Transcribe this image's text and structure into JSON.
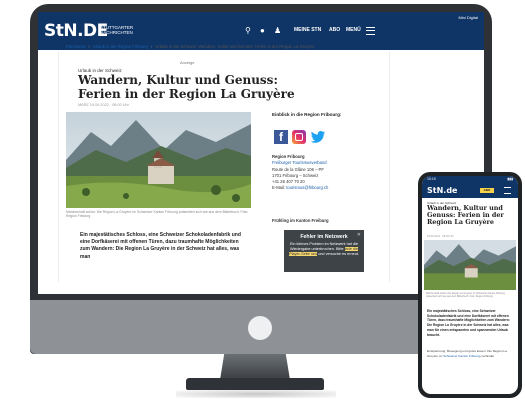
{
  "desktop": {
    "header": {
      "logo": "StN.DE",
      "logo_sub": "STUTTGARTER NACHRICHTEN",
      "corner_label": "Mini Digital",
      "nav": [
        "MEINE STN",
        "ABO",
        "MENÜ"
      ]
    },
    "breadcrumbs": [
      "Panorama",
      "Urlaub in der Region Fribourg",
      "Urlaub in der Schweiz: Wandern, Kultur und Genuss: Ferien in der Region La Gruyère"
    ],
    "article": {
      "ad_label": "Anzeige",
      "kicker": "Urlaub in der Schweiz",
      "headline": "Wandern, Kultur und Genuss: Ferien in der Region La Gruyère",
      "dateline": "MÄRZ 19.09.2022 · 08:00 Uhr",
      "photo_caption": "Märchenhaft schön: Die Region La Gruyère im Schweizer Kanton Fribourg präsentiert sich wie aus dem Bilderbuch. Foto: Region Fribourg",
      "lead": "Ein majestätisches Schloss, eine Schweizer Schokoladenfabrik und eine Dorfkäserei mit offenen Türen, dazu traumhafte Möglichkeiten zum Wandern: Die Region La Gruyère in der Schweiz hat alles, was man"
    },
    "sidebar": {
      "heading": "Einblick in die Region Fribourg:",
      "social_icons": [
        "facebook-icon",
        "instagram-icon",
        "twitter-icon"
      ],
      "org": "Region Fribourg",
      "org_link": "Freiburger Tourismusverband",
      "address1": "Route de la Glâne 106 – PF",
      "address2": "1701 Fribourg – Schweiz",
      "phone": "+41 26 407 70 20",
      "email_label": "E-Mail:",
      "email": "tourismus@fribourg.ch",
      "section": "Frühling im Kanton Freiburg",
      "error_title": "Fehler im Netzwerk",
      "error_text_1": "Ein kleines Problem im Netzwerk hat",
      "error_text_2": "die Wiedergabe unterbrochen. Bitte",
      "error_highlight": "lade die Player-Seite neu",
      "error_text_3": "und versuche es erneut."
    }
  },
  "phone": {
    "status_time": "10:19",
    "logo": "StN.de",
    "abo": "ABO",
    "kicker": "Urlaub in der Schweiz",
    "headline": "Wandern, Kultur und Genuss: Ferien in der Region La Gruyère",
    "dateline": "19.09.2022 · 08:00 Uhr",
    "photo_caption": "Märchenhaft schön: Die Region La Gruyère im Schweizer Kanton Fribourg präsentiert sich wie aus dem Bilderbuch. Foto: Region Fribourg",
    "lead": "Ein majestätisches Schloss, eine Schweizer Schokoladenfabrik und eine Dorfkäserei mit offenen Türen, dazu traumhafte Möglichkeiten zum Wandern: Die Region La Gruyère in der Schweiz hat alles, was man für einen entspannten und spannenden Urlaub braucht.",
    "body_1": "Entspannung, Bewegung und gutes Essen: Die Region La Gruyère im",
    "body_link": "Schweizer Kanton Fribourg",
    "body_2": "verbindet"
  },
  "colors": {
    "brand_navy": "#0f3466",
    "link_blue": "#1a5fa8",
    "monitor_bezel": "#2e3236"
  }
}
